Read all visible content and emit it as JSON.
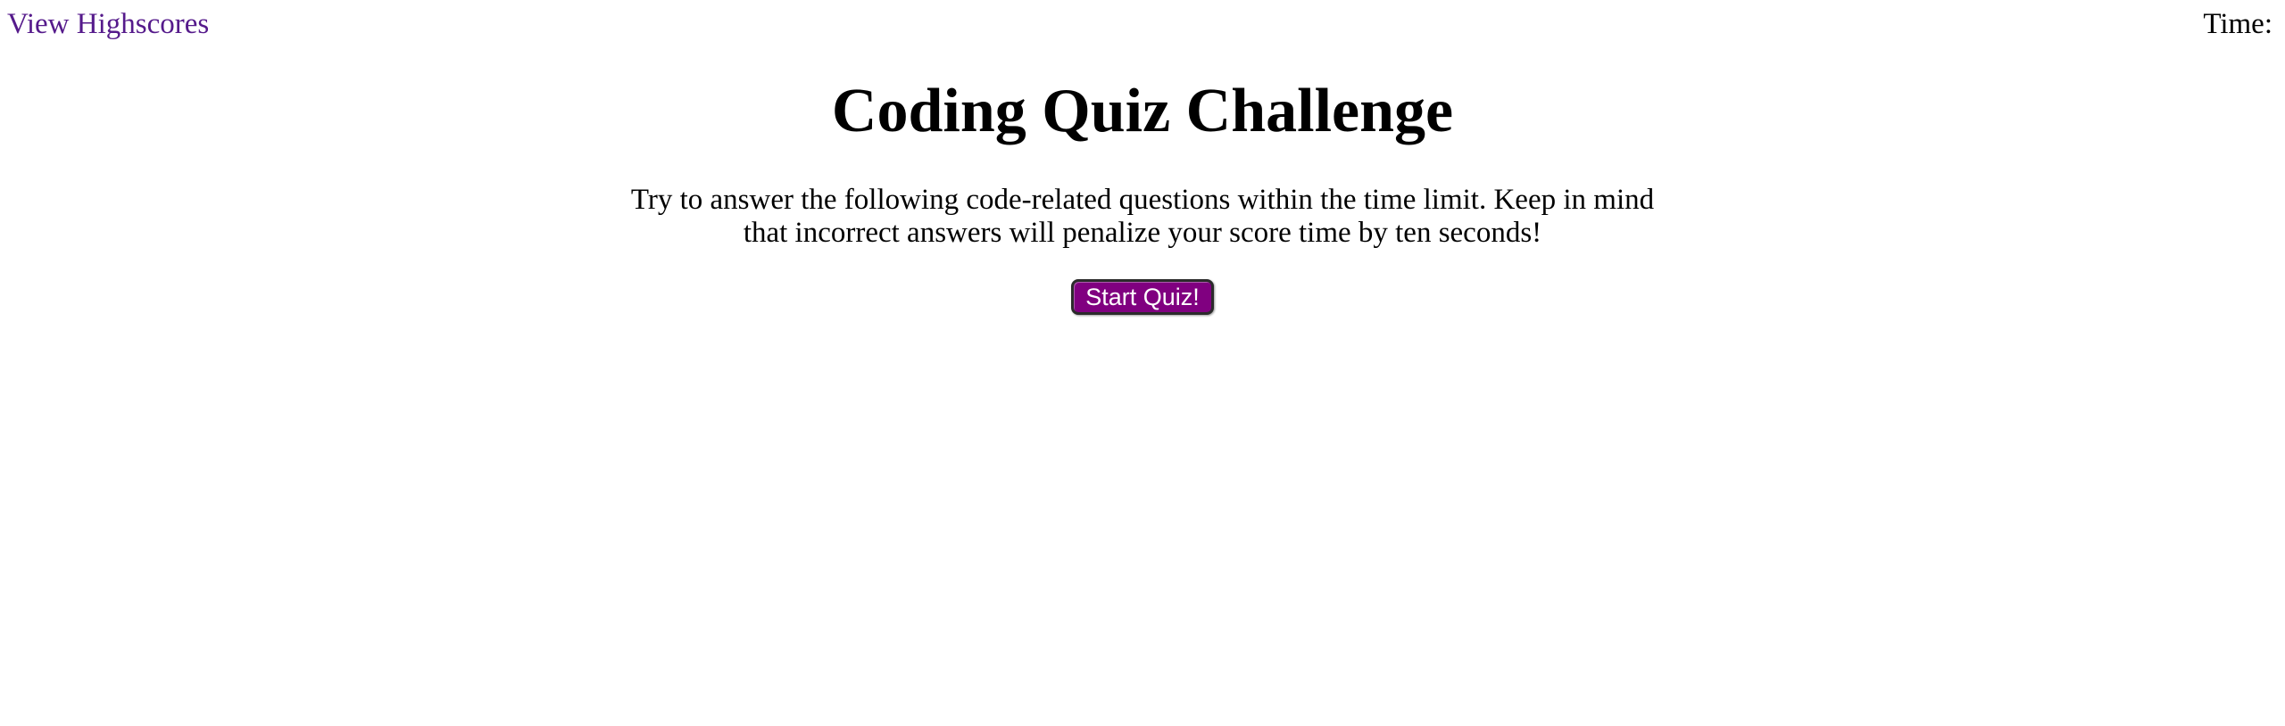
{
  "header": {
    "highscores_link": "View Highscores",
    "timer_label": "Time:",
    "timer_value": ""
  },
  "intro": {
    "title": "Coding Quiz Challenge",
    "description": "Try to answer the following code-related questions within the time limit. Keep in mind that incorrect answers will penalize your score time by ten seconds!",
    "start_button": "Start Quiz!"
  },
  "colors": {
    "link": "#551a8b",
    "button_background": "#800080",
    "button_text": "#ffffff",
    "text": "#000000",
    "page_background": "#ffffff"
  }
}
